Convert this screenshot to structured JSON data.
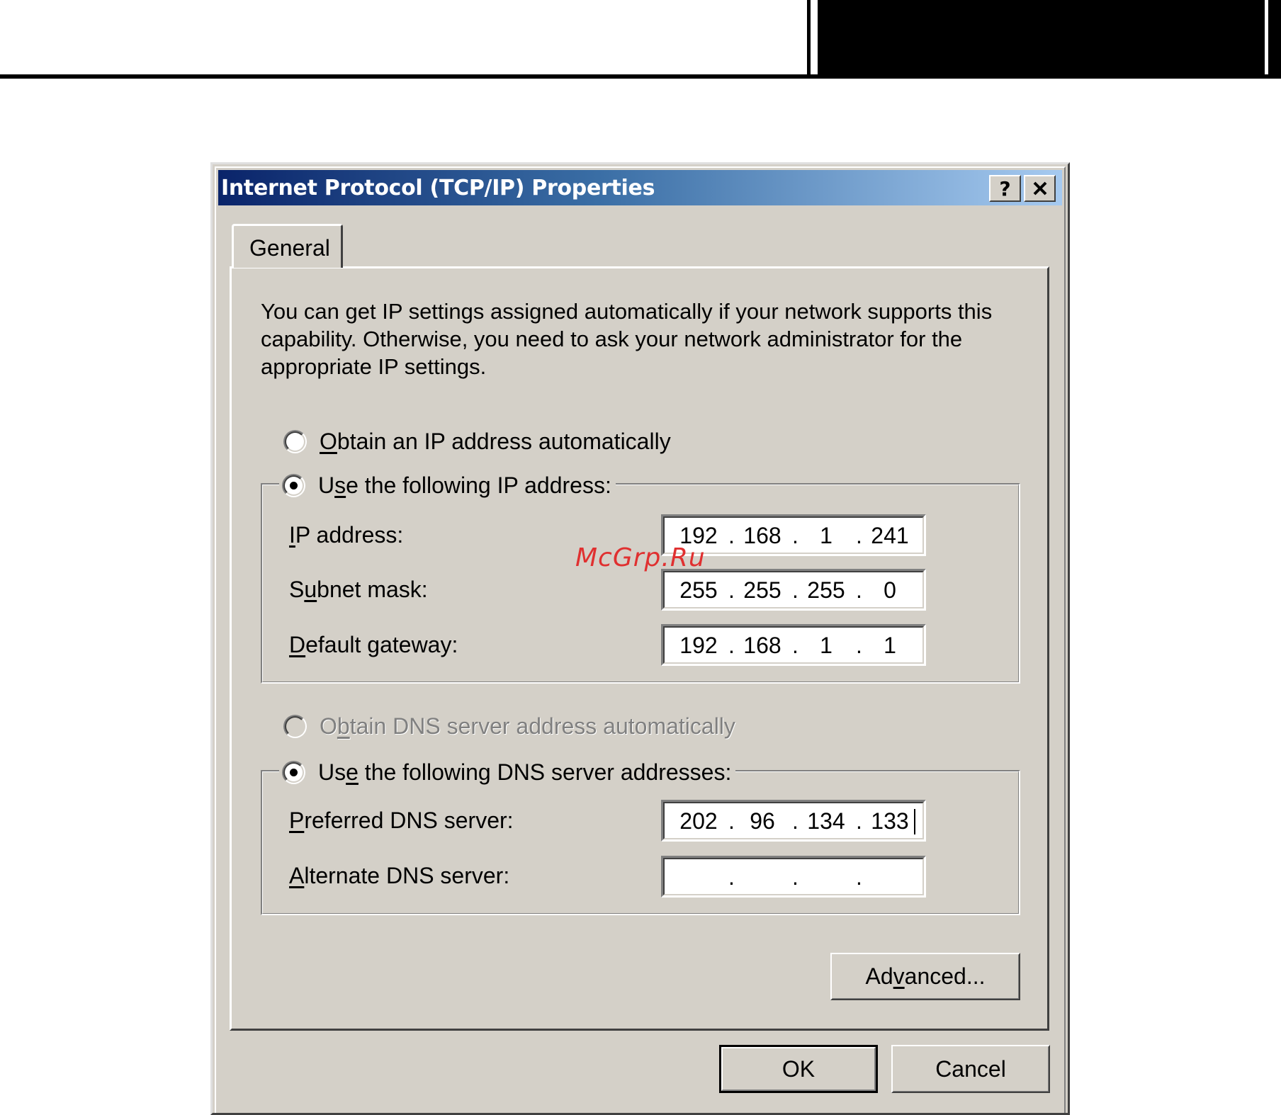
{
  "window": {
    "title": "Internet Protocol (TCP/IP) Properties",
    "help_button": "?",
    "close_button": "✕"
  },
  "tabs": [
    {
      "label": "General",
      "selected": true
    }
  ],
  "intro_text": "You can get IP settings assigned automatically if your network supports this capability. Otherwise, you need to ask your network administrator for the appropriate IP settings.",
  "ip_mode": {
    "auto": {
      "pre": "",
      "key": "O",
      "post": "btain an IP address automatically",
      "selected": false,
      "enabled": true
    },
    "manual": {
      "pre": "U",
      "key": "s",
      "post": "e the following IP address:",
      "selected": true,
      "enabled": true
    }
  },
  "ip_fields": [
    {
      "pre": "",
      "key": "I",
      "post": "P address:",
      "octets": [
        "192",
        "168",
        "1",
        "241"
      ]
    },
    {
      "pre": "S",
      "key": "u",
      "post": "bnet mask:",
      "octets": [
        "255",
        "255",
        "255",
        "0"
      ]
    },
    {
      "pre": "",
      "key": "D",
      "post": "efault gateway:",
      "octets": [
        "192",
        "168",
        "1",
        "1"
      ]
    }
  ],
  "dns_mode": {
    "auto": {
      "pre": "O",
      "key": "b",
      "post": "tain DNS server address automatically",
      "selected": false,
      "enabled": false
    },
    "manual": {
      "pre": "Us",
      "key": "e",
      "post": " the following DNS server addresses:",
      "selected": true,
      "enabled": true
    }
  },
  "dns_fields": [
    {
      "pre": "",
      "key": "P",
      "post": "referred DNS server:",
      "octets": [
        "202",
        "96",
        "134",
        "133"
      ],
      "focused": true
    },
    {
      "pre": "",
      "key": "A",
      "post": "lternate DNS server:",
      "octets": [
        "",
        "",
        "",
        ""
      ],
      "focused": false
    }
  ],
  "buttons": {
    "advanced": {
      "pre": "Ad",
      "key": "v",
      "post": "anced..."
    },
    "ok": "OK",
    "cancel": "Cancel"
  },
  "separator": ".",
  "watermark": "McGrp.Ru"
}
